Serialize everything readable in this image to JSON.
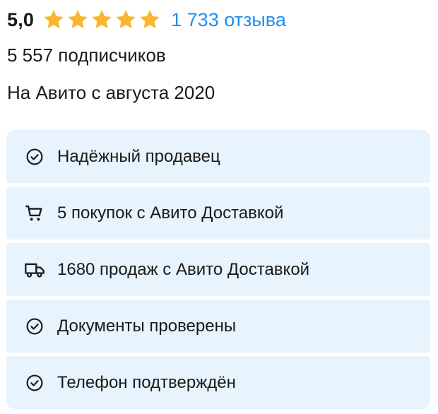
{
  "rating": {
    "value": "5,0",
    "stars": 5,
    "star_color": "#f7b731",
    "reviews_label": "1 733 отзыва",
    "link_color": "#1f8ef1"
  },
  "subscribers_text": "5 557 подписчиков",
  "since_text": "На Авито с августа 2020",
  "badge_bg": "#e7f3fd",
  "badges": [
    {
      "icon": "check-circle-icon",
      "label": "Надёжный продавец"
    },
    {
      "icon": "cart-icon",
      "label": "5 покупок с Авито Доставкой"
    },
    {
      "icon": "truck-icon",
      "label": "1680 продаж с Авито Доставкой"
    },
    {
      "icon": "check-circle-icon",
      "label": "Документы проверены"
    },
    {
      "icon": "check-circle-icon",
      "label": "Телефон подтверждён"
    }
  ]
}
